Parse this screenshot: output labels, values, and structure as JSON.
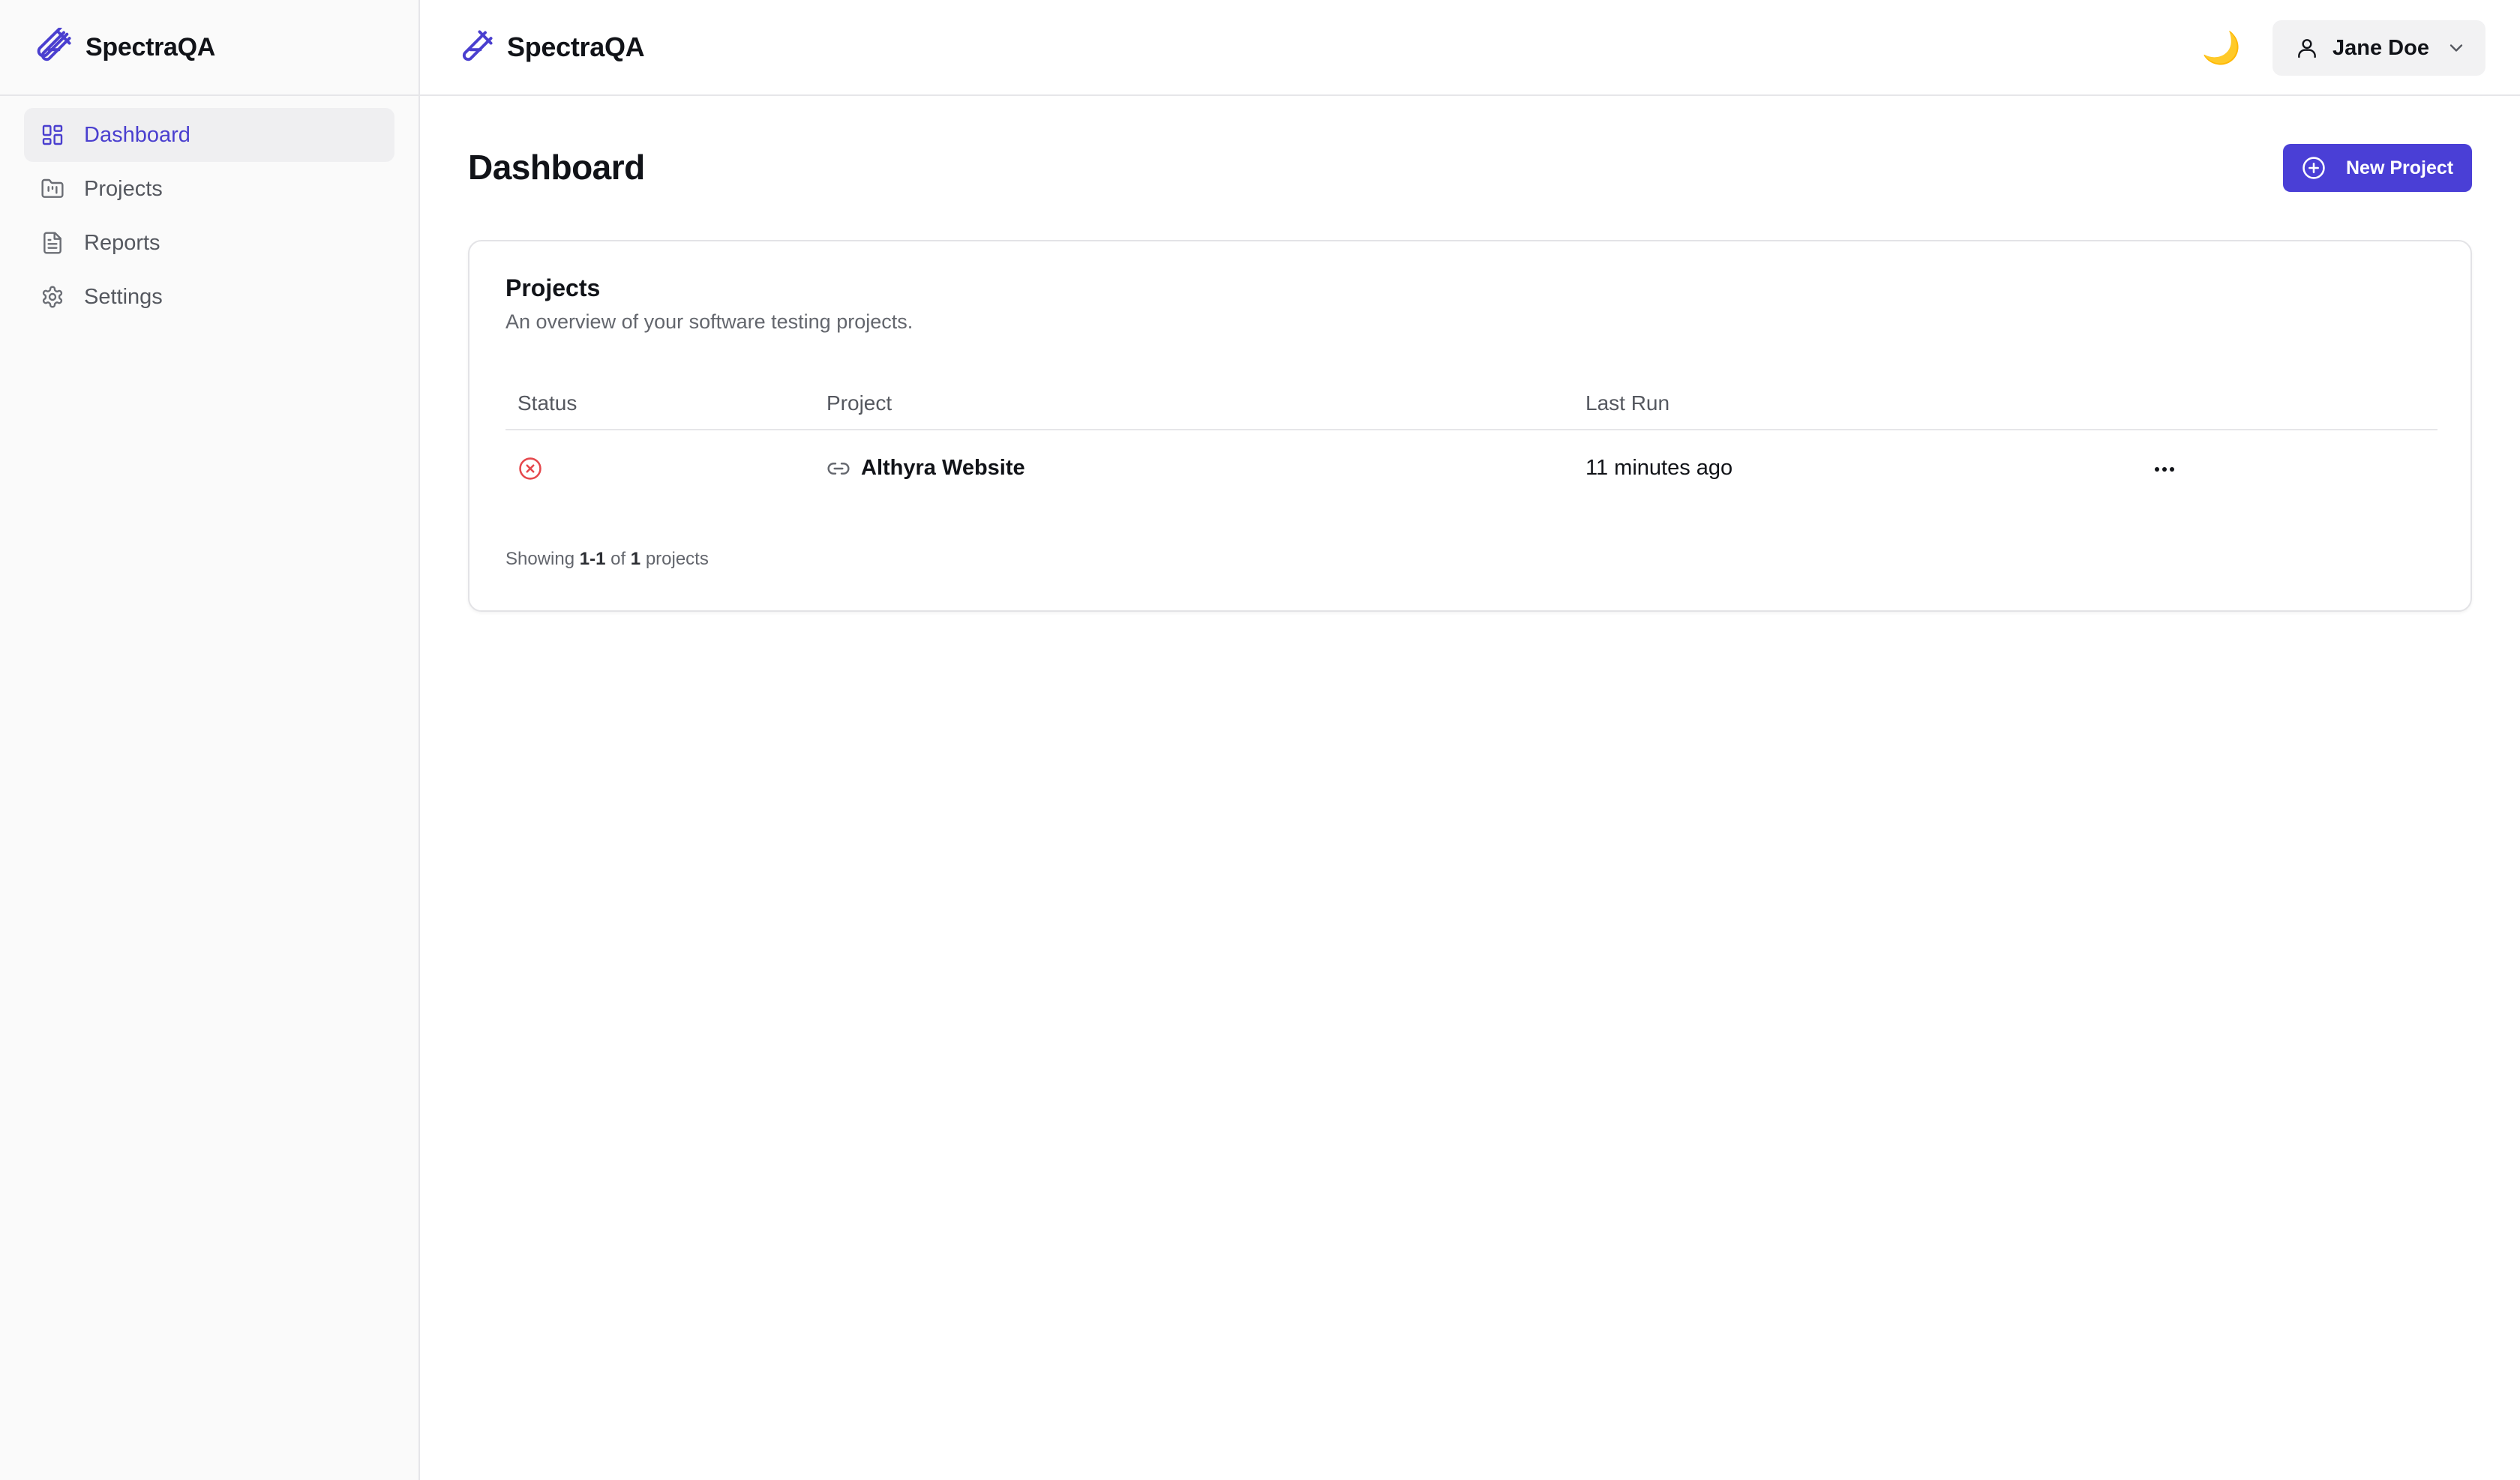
{
  "app": {
    "name": "SpectraQA"
  },
  "sidebar": {
    "items": [
      {
        "label": "Dashboard",
        "icon": "dashboard-icon",
        "active": true
      },
      {
        "label": "Projects",
        "icon": "folder-icon",
        "active": false
      },
      {
        "label": "Reports",
        "icon": "report-icon",
        "active": false
      },
      {
        "label": "Settings",
        "icon": "gear-icon",
        "active": false
      }
    ]
  },
  "header": {
    "theme_toggle": "🌙",
    "user": {
      "name": "Jane Doe"
    }
  },
  "main": {
    "title": "Dashboard",
    "new_project_label": "New Project",
    "card": {
      "title": "Projects",
      "description": "An overview of your software testing projects.",
      "columns": [
        "Status",
        "Project",
        "Last Run"
      ],
      "rows": [
        {
          "status": "failed",
          "project": "Althyra Website",
          "last_run": "11 minutes ago"
        }
      ],
      "footer": {
        "prefix": "Showing",
        "range": "1-1",
        "of": "of",
        "total": "1",
        "suffix": "projects"
      }
    }
  },
  "colors": {
    "accent": "#4a3fd6",
    "status_failed": "#e5484d",
    "sidebar_bg": "#fafafa"
  }
}
